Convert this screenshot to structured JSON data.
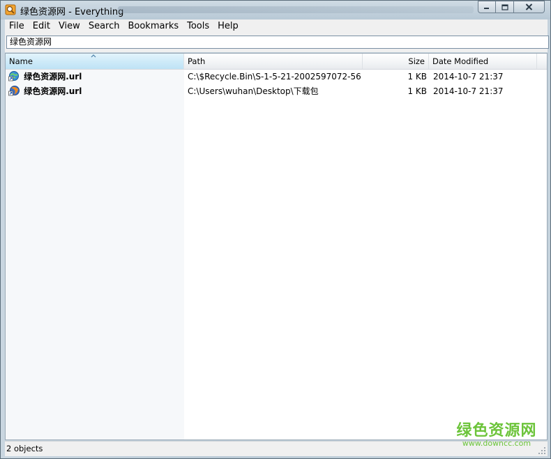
{
  "window": {
    "title": "绿色资源网 - Everything",
    "icon": "everything-app-icon"
  },
  "menu": {
    "items": [
      "File",
      "Edit",
      "View",
      "Search",
      "Bookmarks",
      "Tools",
      "Help"
    ]
  },
  "search": {
    "value": "绿色资源网"
  },
  "columns": {
    "name": "Name",
    "path": "Path",
    "size": "Size",
    "date": "Date Modified"
  },
  "rows": [
    {
      "name": "绿色资源网.url",
      "icon": "internet-shortcut-icon",
      "path": "C:\\$Recycle.Bin\\S-1-5-21-2002597072-56...",
      "size": "1 KB",
      "date": "2014-10-7 21:37"
    },
    {
      "name": "绿色资源网.url",
      "icon": "firefox-shortcut-icon",
      "path": "C:\\Users\\wuhan\\Desktop\\下载包",
      "size": "1 KB",
      "date": "2014-10-7 21:37"
    }
  ],
  "status": {
    "text": "2 objects"
  },
  "watermark": {
    "title": "绿色资源网",
    "url": "www.downcc.com"
  },
  "colors": {
    "accent": "#6cc43a",
    "header_selected": "#cdeaf8"
  }
}
